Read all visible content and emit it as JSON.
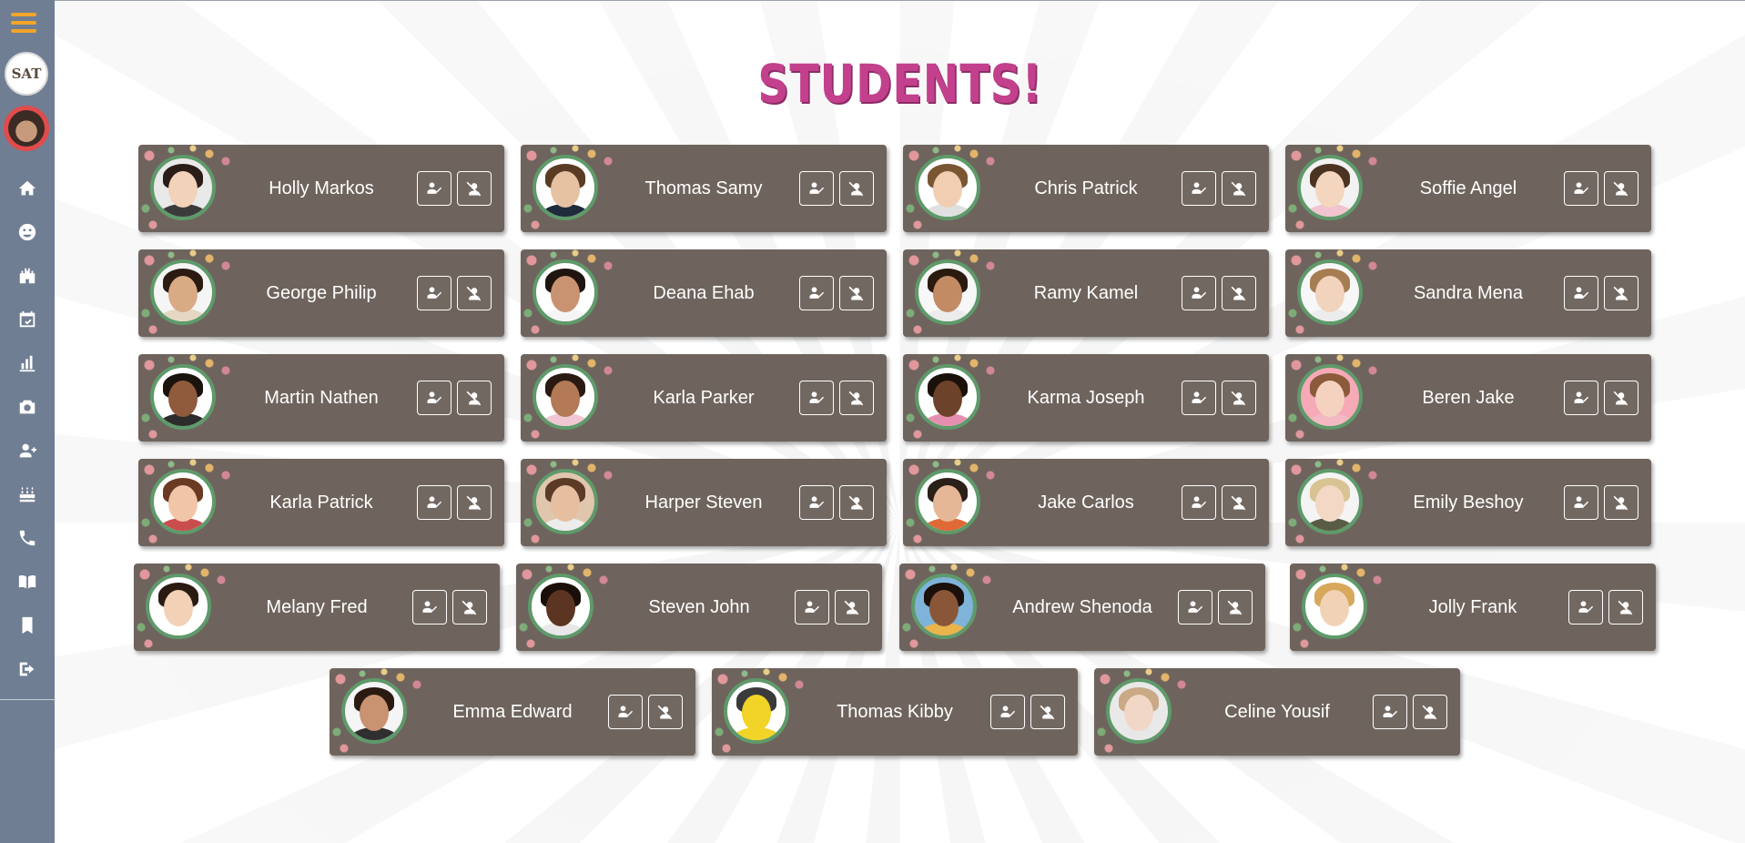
{
  "page": {
    "title": "STUDENTS!"
  },
  "sidebar": {
    "logo_text": "SAT",
    "items": [
      {
        "icon": "home-icon"
      },
      {
        "icon": "smiley-icon"
      },
      {
        "icon": "castle-icon"
      },
      {
        "icon": "calendar-icon"
      },
      {
        "icon": "bar-chart-icon"
      },
      {
        "icon": "camera-icon"
      },
      {
        "icon": "add-user-icon"
      },
      {
        "icon": "birthday-cake-icon"
      },
      {
        "icon": "phone-icon"
      },
      {
        "icon": "open-book-icon"
      },
      {
        "icon": "bookmark-icon"
      },
      {
        "icon": "sign-out-icon"
      }
    ]
  },
  "colors": {
    "sidebar": "#6f7e93",
    "menu": "#f2a52a",
    "title": "#c2408c",
    "card": "#6e645d",
    "photo_ring": "#5f9a6a"
  },
  "students": [
    {
      "name": "Holly Markos"
    },
    {
      "name": "Thomas Samy"
    },
    {
      "name": "Chris Patrick"
    },
    {
      "name": "Soffie Angel"
    },
    {
      "name": "George Philip"
    },
    {
      "name": "Deana Ehab"
    },
    {
      "name": "Ramy Kamel"
    },
    {
      "name": "Sandra Mena"
    },
    {
      "name": "Martin Nathen"
    },
    {
      "name": "Karla Parker"
    },
    {
      "name": "Karma Joseph"
    },
    {
      "name": "Beren Jake"
    },
    {
      "name": "Karla Patrick"
    },
    {
      "name": "Harper Steven"
    },
    {
      "name": "Jake Carlos"
    },
    {
      "name": "Emily Beshoy"
    },
    {
      "name": "Melany Fred"
    },
    {
      "name": "Steven John"
    },
    {
      "name": "Andrew Shenoda"
    },
    {
      "name": "Jolly Frank"
    },
    {
      "name": "Emma Edward"
    },
    {
      "name": "Thomas Kibby"
    },
    {
      "name": "Celine Yousif"
    }
  ]
}
